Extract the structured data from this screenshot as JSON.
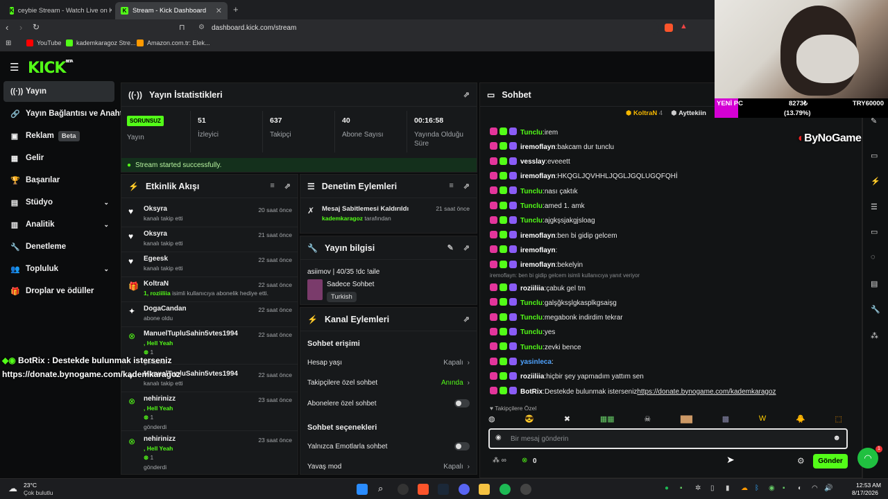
{
  "browser": {
    "tabs": [
      {
        "title": "ceybie Stream - Watch Live on Ki"
      },
      {
        "title": "Stream - Kick Dashboard"
      }
    ],
    "url": "dashboard.kick.com/stream",
    "bookmarks": [
      "YouTube",
      "kademkaragoz Stre...",
      "Amazon.com.tr: Elek..."
    ]
  },
  "app": {
    "logo": "KICK",
    "logo_tag": "BETA"
  },
  "sidebar": {
    "items": [
      {
        "label": "Yayın",
        "icon": "signal-icon"
      },
      {
        "label": "Yayın Bağlantısı ve Anahtar",
        "icon": "link-icon"
      },
      {
        "label": "Reklam",
        "badge": "Beta",
        "icon": "ad-icon"
      },
      {
        "label": "Gelir",
        "icon": "calculator-icon"
      },
      {
        "label": "Başarılar",
        "icon": "trophy-icon"
      },
      {
        "label": "Stüdyo",
        "icon": "studio-icon"
      },
      {
        "label": "Analitik",
        "icon": "analytics-icon"
      },
      {
        "label": "Denetleme",
        "icon": "wrench-icon"
      },
      {
        "label": "Topluluk",
        "icon": "community-icon"
      },
      {
        "label": "Droplar ve ödüller",
        "icon": "gift-icon"
      }
    ]
  },
  "stats": {
    "title": "Yayın İstatistikleri",
    "problem_badge": "SORUNSUZ",
    "stream_label": "Yayın",
    "items": [
      {
        "value": "51",
        "label": "İzleyici"
      },
      {
        "value": "637",
        "label": "Takipçi"
      },
      {
        "value": "40",
        "label": "Abone Sayısı"
      },
      {
        "value": "00:16:58",
        "label": "Yayında Olduğu Süre"
      }
    ],
    "success": "Stream started successfully."
  },
  "activity": {
    "title": "Etkinlik Akışı",
    "items": [
      {
        "name": "Oksyra",
        "sub": "kanalı takip etti",
        "time": "20 saat önce"
      },
      {
        "name": "Oksyra",
        "sub": "kanalı takip etti",
        "time": "21 saat önce"
      },
      {
        "name": "Egeesk",
        "sub": "kanalı takip etti",
        "time": "22 saat önce"
      },
      {
        "name": "KoltraN",
        "sub_hl": "1, roziiliia",
        "sub": " isimli kullanıcıya abonelik hediye etti.",
        "time": "22 saat önce"
      },
      {
        "name": "DogaCandan",
        "sub": "abone oldu",
        "time": "22 saat önce"
      },
      {
        "name": "ManuelTupluSahin5vtes1994",
        "sub_hl": ", Hell Yeah",
        "sub2": "1",
        "sub3": "gönderdi",
        "time": "22 saat önce"
      },
      {
        "name": "ManuelTupluSahin5vtes1994",
        "sub": "kanalı takip etti",
        "time": "22 saat önce"
      },
      {
        "name": "nehirinizz",
        "sub_hl": ", Hell Yeah",
        "sub2": "1",
        "sub3": "gönderdi",
        "time": "23 saat önce"
      },
      {
        "name": "nehirinizz",
        "sub_hl": ", Hell Yeah",
        "sub2": "1",
        "sub3": "gönderdi",
        "time": "23 saat önce"
      }
    ]
  },
  "moderation": {
    "title": "Denetim Eylemleri",
    "item": {
      "title": "Mesaj Sabitlemesi Kaldırıldı",
      "by": "kademkaragoz",
      "by_suffix": " tarafından",
      "time": "21 saat önce"
    }
  },
  "stream_info": {
    "title": "Yayın bilgisi",
    "stream_title": "asiimov | 40/35 !dc !aile",
    "category": "Sadece Sohbet",
    "tag": "Turkish"
  },
  "channel_actions": {
    "title": "Kanal Eylemleri",
    "section1": "Sohbet erişimi",
    "rows1": [
      {
        "label": "Hesap yaşı",
        "value": "Kapalı"
      },
      {
        "label": "Takipçilere özel sohbet",
        "value": "Anında"
      },
      {
        "label": "Abonelere özel sohbet",
        "value": ""
      }
    ],
    "section2": "Sohbet seçenekleri",
    "rows2": [
      {
        "label": "Yalnızca Emotlarla sohbet",
        "value": ""
      },
      {
        "label": "Yavaş mod",
        "value": "Kapalı"
      }
    ]
  },
  "chat": {
    "title": "Sohbet",
    "pinned_users": [
      {
        "name": "KoltraN",
        "count": "4"
      },
      {
        "name": "Ayttekiin",
        "count": ""
      }
    ],
    "messages": [
      {
        "user": "Tunclu",
        "color": "#53fc18",
        "text": "irem"
      },
      {
        "user": "iremoflayn",
        "color": "#ffffff",
        "text": "bakcam dur tunclu"
      },
      {
        "user": "vesslay",
        "color": "#ffffff",
        "text": "eveeett"
      },
      {
        "user": "iremoflayn",
        "color": "#ffffff",
        "text": "HKQGLJQVHHLJQGLJGQLUGQFQHİ"
      },
      {
        "user": "Tunclu",
        "color": "#53fc18",
        "text": "nası çaktık"
      },
      {
        "user": "Tunclu",
        "color": "#53fc18",
        "text": "amed 1. amk"
      },
      {
        "user": "Tunclu",
        "color": "#53fc18",
        "text": "ajgkşsjakgjsloag"
      },
      {
        "user": "iremoflayn",
        "color": "#ffffff",
        "text": "ben bi gidip gelcem"
      },
      {
        "user": "iremoflayn",
        "color": "#ffffff",
        "text": ""
      },
      {
        "user": "iremoflayn",
        "color": "#ffffff",
        "text": "bekelyin"
      },
      {
        "user": "roziiliia",
        "color": "#ffffff",
        "text": "çabuk gel tm",
        "reply": "iremoflayn: ben bi gidip gelcem isimli kullanıcıya yanıt veriyor"
      },
      {
        "user": "Tunclu",
        "color": "#53fc18",
        "text": "galşğksşlgkasplkgsaişg"
      },
      {
        "user": "Tunclu",
        "color": "#53fc18",
        "text": "megabonk indirdim tekrar"
      },
      {
        "user": "Tunclu",
        "color": "#53fc18",
        "text": "yes"
      },
      {
        "user": "Tunclu",
        "color": "#53fc18",
        "text": "zevki bence"
      },
      {
        "user": "yasinleca",
        "color": "#4fa3ff",
        "text": ""
      },
      {
        "user": "roziiliia",
        "color": "#ffffff",
        "text": "hiçbir şey yapmadım yattım sen"
      },
      {
        "user": "BotRix",
        "color": "#ffffff",
        "text": "Destekde bulunmak isterseniz ",
        "link": "https://donate.bynogame.com/kademkaragoz"
      }
    ],
    "followers_only": "Takipçilere Özel",
    "input_placeholder": "Bir mesaj gönderin",
    "points": "0",
    "send": "Gönder"
  },
  "overlay": {
    "cam_label1": "YENİ PC",
    "cam_value": "8273₺",
    "cam_goal": "TRY60000",
    "cam_pct": "(13.79%)",
    "bynogame": "ByNoGame",
    "botrix_line1": "BotRix : Destekde bulunmak isterseniz",
    "botrix_line2": "https://donate.bynogame.com/kademkaragoz"
  },
  "taskbar": {
    "weather_temp": "23°C",
    "weather_desc": "Çok bulutlu",
    "time": "12:53 AM",
    "date": "8/17/2026"
  }
}
